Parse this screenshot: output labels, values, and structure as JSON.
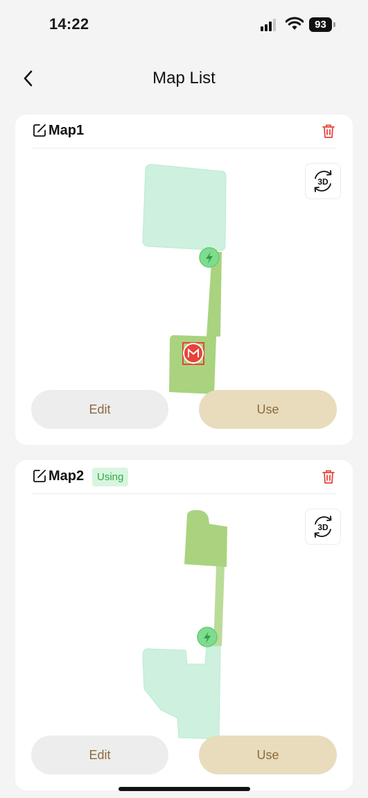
{
  "status_bar": {
    "time": "14:22",
    "battery_level": "93",
    "icons": [
      "cellular-signal-icon",
      "wifi-icon",
      "battery-icon"
    ]
  },
  "header": {
    "title": "Map List",
    "back_icon": "chevron-left-icon"
  },
  "maps": [
    {
      "name": "Map1",
      "status": "",
      "view_3d_label": "3D",
      "edit_label": "Edit",
      "use_label": "Use"
    },
    {
      "name": "Map2",
      "status": "Using",
      "view_3d_label": "3D",
      "edit_label": "Edit",
      "use_label": "Use"
    }
  ],
  "colors": {
    "accent_text": "#8a6a3c",
    "use_button_bg": "#e8dcbd",
    "edit_button_bg": "#ededed",
    "delete_red": "#e5453a",
    "using_green": "#2fa84a",
    "zone_light": "#cdf1de",
    "zone_dark": "#a9d37f",
    "charger_green": "#7fdc8f"
  }
}
